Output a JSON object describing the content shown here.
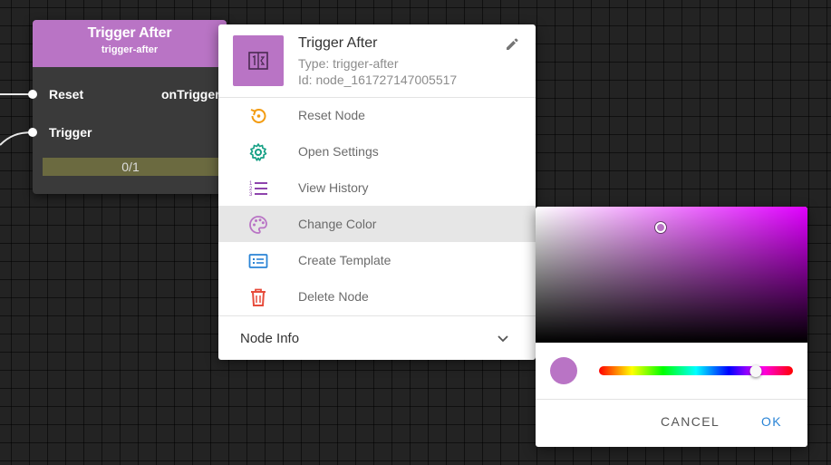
{
  "node": {
    "title": "Trigger After",
    "subtitle": "trigger-after",
    "inputs": [
      "Reset",
      "Trigger"
    ],
    "output": "onTrigger",
    "progress": "0/1",
    "color": "#b974c5"
  },
  "menu": {
    "title": "Trigger After",
    "type_text": "Type: trigger-after",
    "id_text": "Id: node_161727147005517",
    "items": [
      {
        "label": "Reset Node",
        "icon": "reset-icon",
        "color": "#f39c12"
      },
      {
        "label": "Open Settings",
        "icon": "gear-icon",
        "color": "#16a085"
      },
      {
        "label": "View History",
        "icon": "list-icon",
        "color": "#8e44ad"
      },
      {
        "label": "Change Color",
        "icon": "palette-icon",
        "color": "#b974c5"
      },
      {
        "label": "Create Template",
        "icon": "template-icon",
        "color": "#2a84d6"
      },
      {
        "label": "Delete Node",
        "icon": "trash-icon",
        "color": "#e74c3c"
      }
    ],
    "active_item": "Change Color",
    "node_info_label": "Node Info"
  },
  "color_picker": {
    "hue_color": "#e000ff",
    "selected_color": "#b974c5",
    "saturation": 0.46,
    "value": 0.85,
    "hue_position": 0.81,
    "cancel_label": "CANCEL",
    "ok_label": "OK"
  }
}
